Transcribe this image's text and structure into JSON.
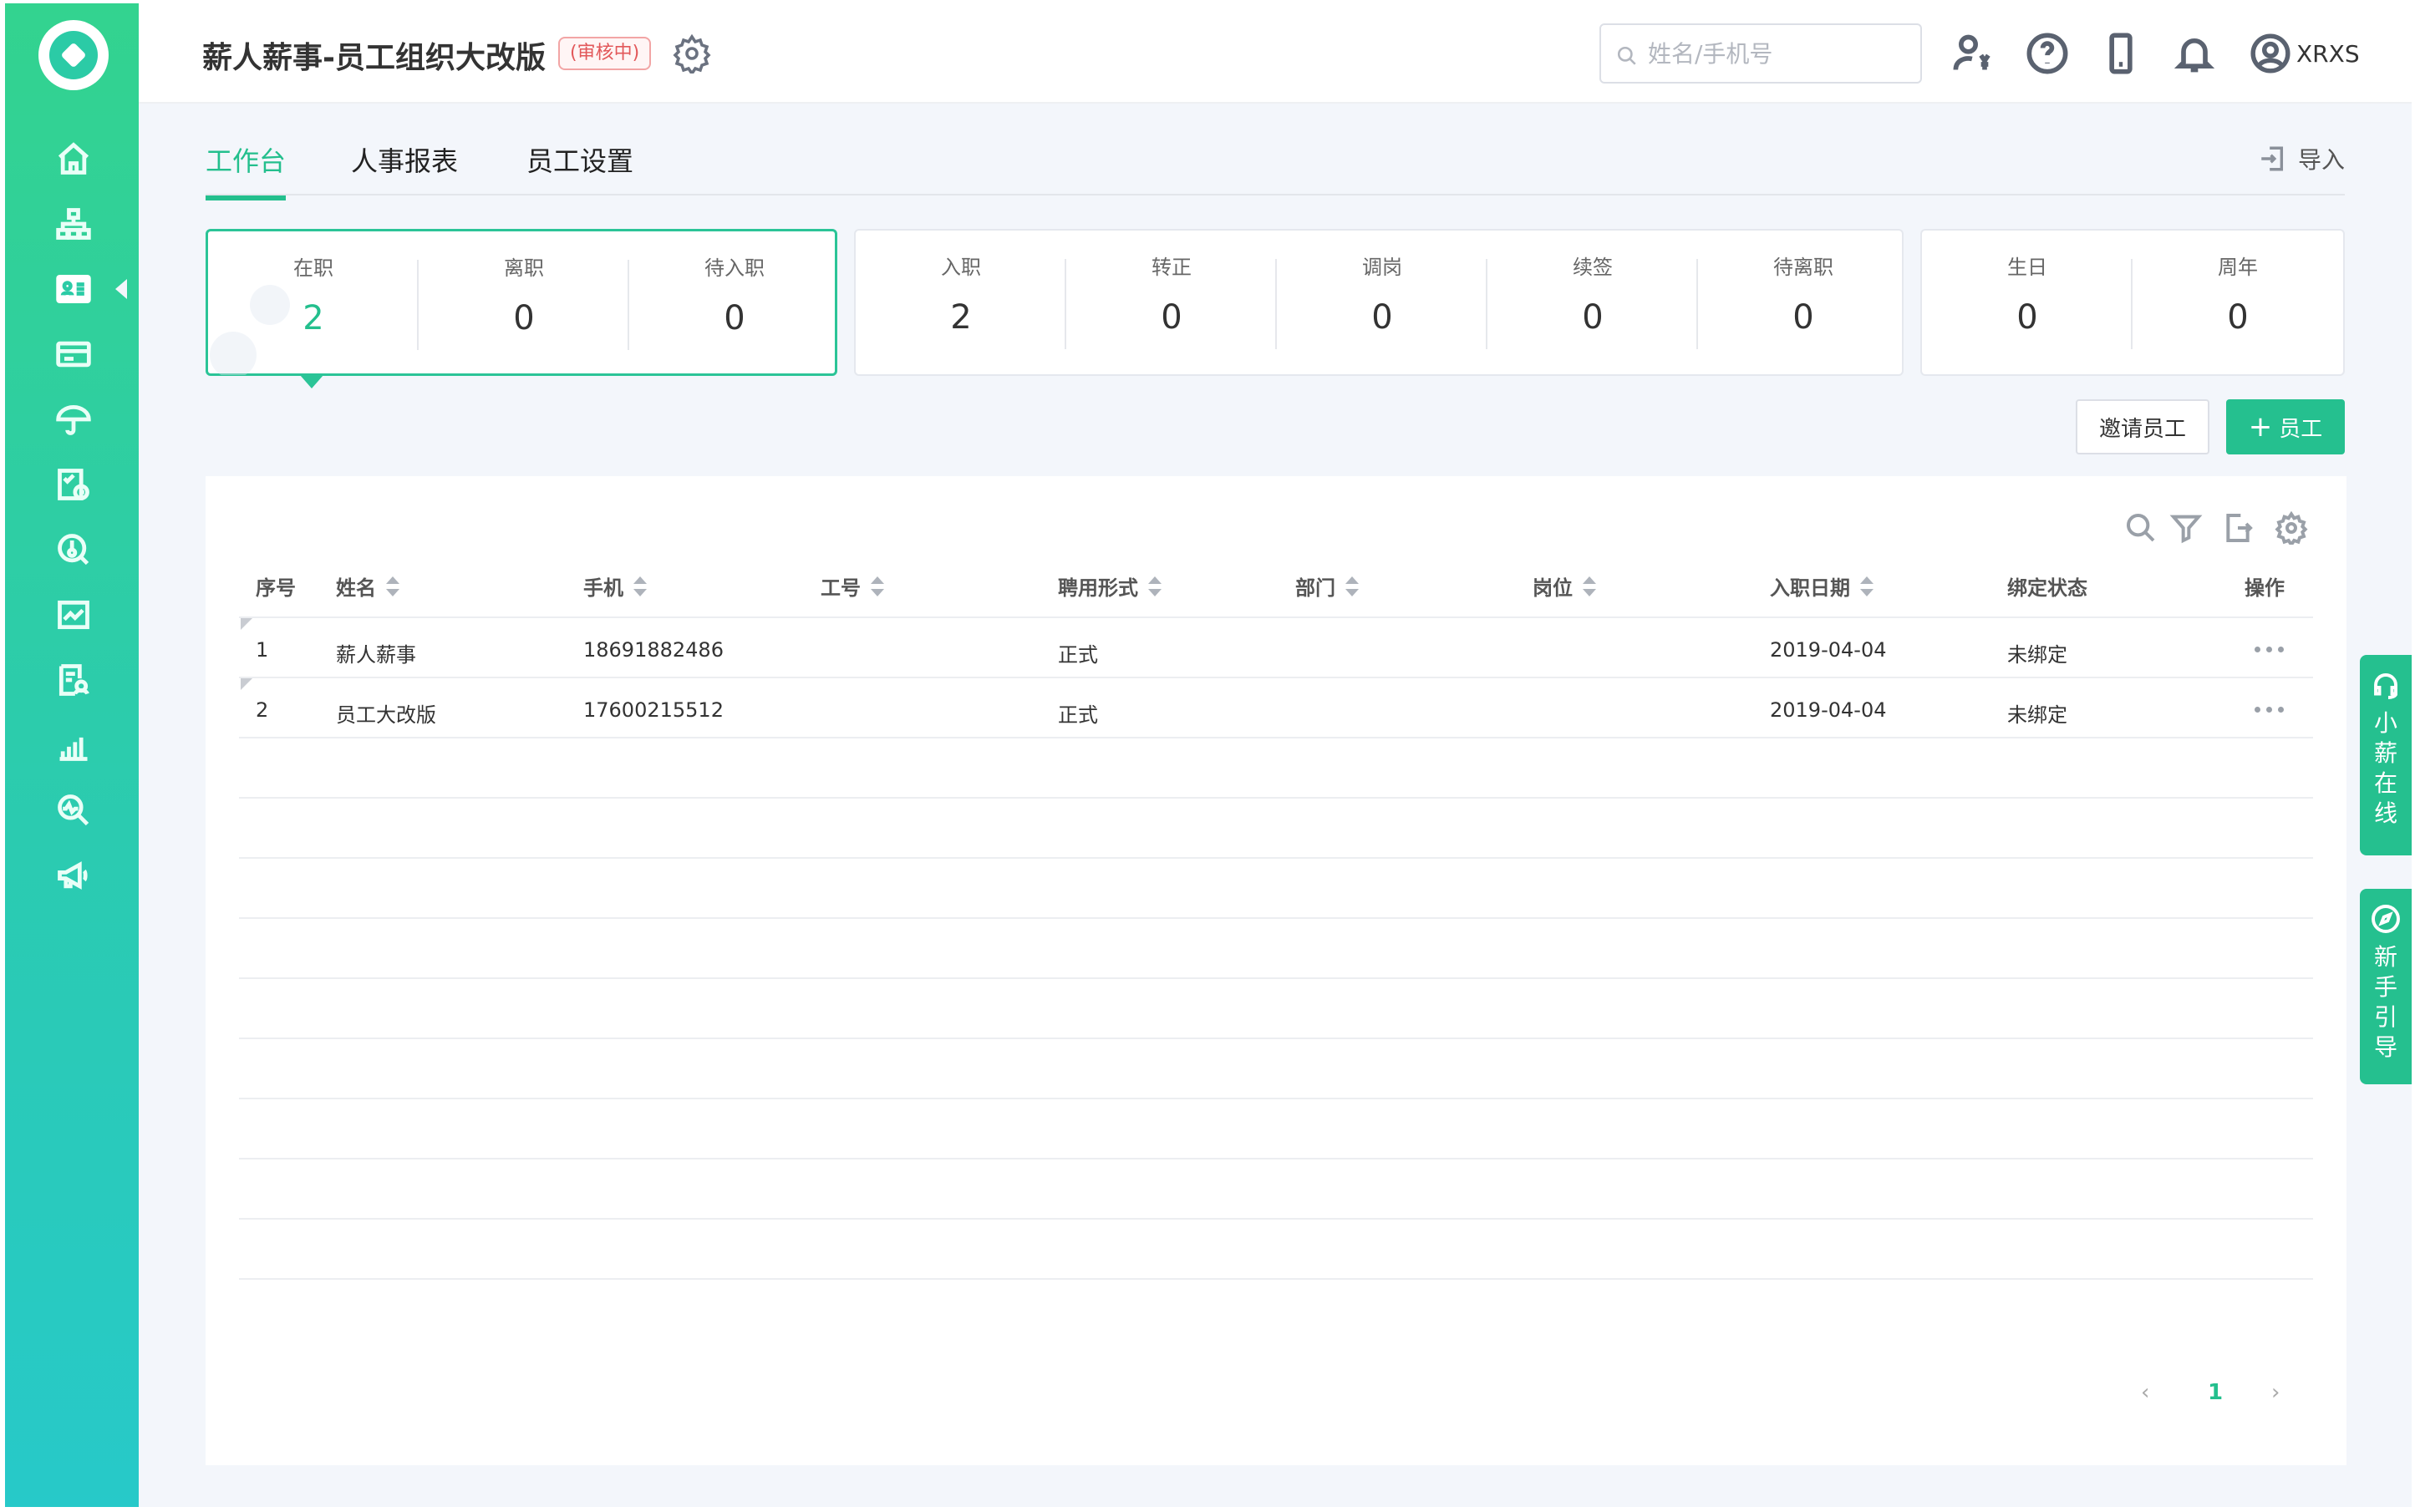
{
  "app": {
    "title": "薪人薪事-员工组织大改版",
    "status_badge": "(审核中)"
  },
  "header": {
    "search_placeholder": "姓名/手机号",
    "username": "XRXS"
  },
  "tabs": [
    {
      "label": "工作台"
    },
    {
      "label": "人事报表"
    },
    {
      "label": "员工设置"
    }
  ],
  "toolbar": {
    "import_label": "导入"
  },
  "stats": {
    "group1": [
      {
        "label": "在职",
        "value": "2"
      },
      {
        "label": "离职",
        "value": "0"
      },
      {
        "label": "待入职",
        "value": "0"
      }
    ],
    "group2": [
      {
        "label": "入职",
        "value": "2"
      },
      {
        "label": "转正",
        "value": "0"
      },
      {
        "label": "调岗",
        "value": "0"
      },
      {
        "label": "续签",
        "value": "0"
      },
      {
        "label": "待离职",
        "value": "0"
      }
    ],
    "group3": [
      {
        "label": "生日",
        "value": "0"
      },
      {
        "label": "周年",
        "value": "0"
      }
    ]
  },
  "actions": {
    "invite": "邀请员工",
    "add": "员工",
    "add_symbol": "+"
  },
  "table": {
    "headers": [
      "序号",
      "姓名",
      "手机",
      "工号",
      "聘用形式",
      "部门",
      "岗位",
      "入职日期",
      "绑定状态",
      "操作"
    ],
    "rows": [
      {
        "index": "1",
        "name": "薪人薪事",
        "phone": "18691882486",
        "emp_no": "",
        "type": "正式",
        "dept": "",
        "position": "",
        "date": "2019-04-04",
        "bind": "未绑定"
      },
      {
        "index": "2",
        "name": "员工大改版",
        "phone": "17600215512",
        "emp_no": "",
        "type": "正式",
        "dept": "",
        "position": "",
        "date": "2019-04-04",
        "bind": "未绑定"
      }
    ]
  },
  "pagination": {
    "current": "1",
    "prev": "‹",
    "next": "›"
  },
  "float": {
    "support": "小薪在线",
    "guide": "新手引导"
  },
  "colors": {
    "accent": "#25c08f",
    "sidebar_top": "#33d38f",
    "sidebar_bottom": "#27c9c9",
    "badge": "#e2585a"
  }
}
